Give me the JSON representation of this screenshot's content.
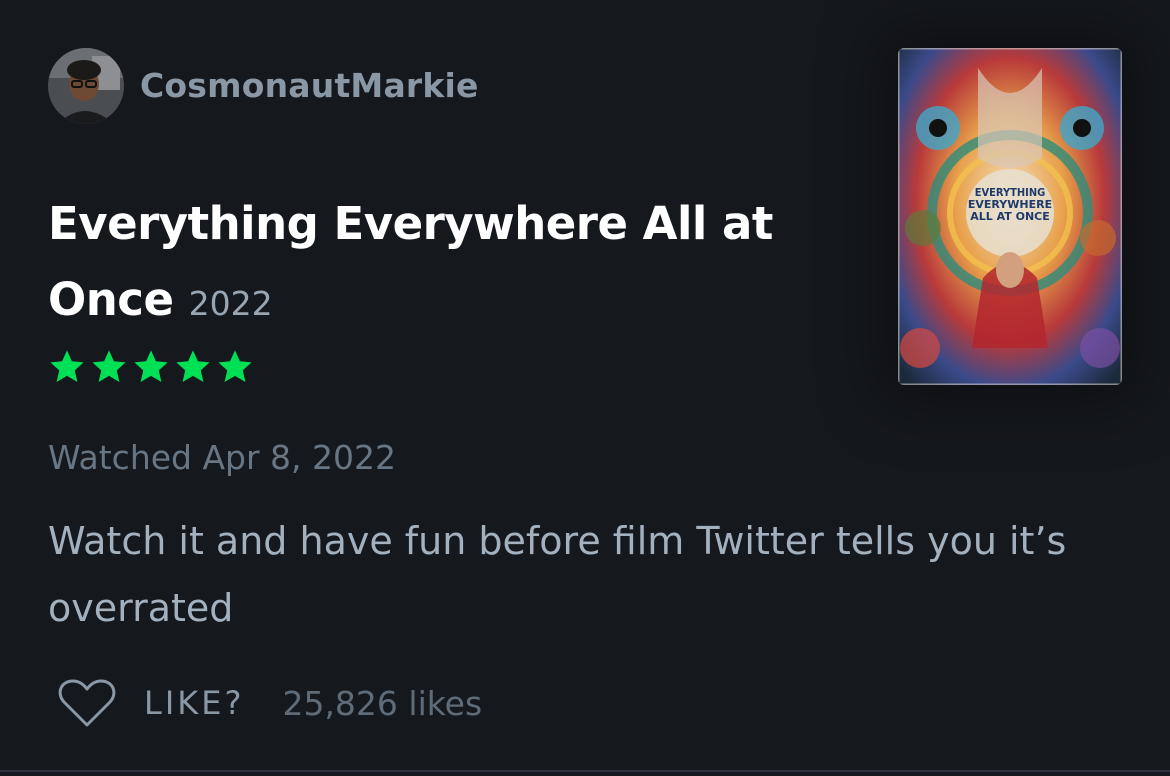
{
  "review": {
    "username": "CosmonautMarkie",
    "film_title": "Everything Everywhere All at Once",
    "film_year": "2022",
    "rating_stars": 5,
    "watched_text": "Watched Apr 8, 2022",
    "review_text": "Watch it and have fun before film Twitter tells you it’s overrated",
    "like_label": "LIKE?",
    "likes_count": "25,826 likes",
    "poster_title_text": "EVERYTHING EVERYWHERE ALL AT ONCE"
  },
  "colors": {
    "background": "#15181d",
    "star_green": "#00e054",
    "username": "#8a98a6",
    "review_text": "#a3b0bd"
  },
  "icons": {
    "star": "star-icon",
    "like": "heart-outline-icon"
  }
}
